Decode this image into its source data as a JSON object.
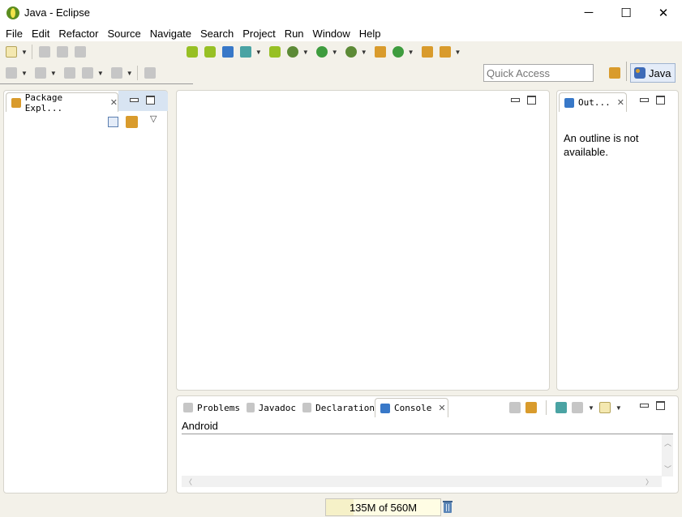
{
  "window": {
    "title": "Java - Eclipse",
    "controls": {
      "minimize": "─",
      "maximize": "☐",
      "close": "✕"
    }
  },
  "menu": [
    "File",
    "Edit",
    "Refactor",
    "Source",
    "Navigate",
    "Search",
    "Project",
    "Run",
    "Window",
    "Help"
  ],
  "toolbar": {
    "quick_access_placeholder": "Quick Access",
    "perspective": "Java"
  },
  "explorer": {
    "tab_label": "Package Expl...",
    "close_glyph": "✕",
    "view_menu_glyph": "▽"
  },
  "outline": {
    "tab_label": "Out...",
    "close_glyph": "✕",
    "message": "An outline is not available."
  },
  "console": {
    "tabs": [
      {
        "label": "Problems",
        "icon": "problems-icon"
      },
      {
        "label": "Javadoc",
        "icon": "javadoc-icon"
      },
      {
        "label": "Declaration",
        "icon": "declaration-icon"
      },
      {
        "label": "Console",
        "icon": "console-icon",
        "active": true
      }
    ],
    "close_glyph": "✕",
    "content_label": "Android"
  },
  "status": {
    "heap": "135M of 560M",
    "heap_used_fraction": 0.24
  },
  "colors": {
    "background": "#f3f1e9",
    "accent": "#3878c8",
    "perspective_active": "#e4ecf8"
  }
}
